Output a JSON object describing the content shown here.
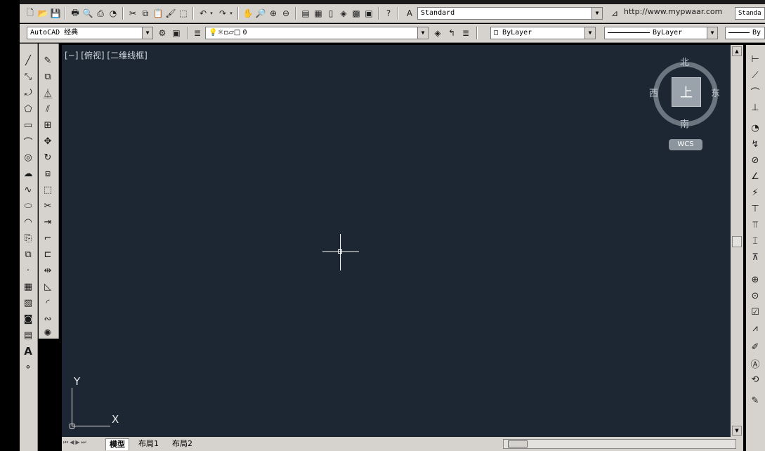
{
  "toolbar": {
    "text_style": "Standard",
    "watermark_url": "http://www.mypwaar.com",
    "table_style_fragment": "Standa",
    "workspace": "AutoCAD 经典",
    "layer": "0",
    "color": "ByLayer",
    "linetype": "ByLayer",
    "lineweight_fragment": "By"
  },
  "viewport": {
    "label": "[−] [俯视] [二维线框]"
  },
  "viewcube": {
    "north": "北",
    "south": "南",
    "east": "东",
    "west": "西",
    "top": "上",
    "wcs": "WCS"
  },
  "ucs": {
    "x_label": "X",
    "y_label": "Y"
  },
  "tabs": [
    {
      "label": "模型"
    },
    {
      "label": "布局1"
    },
    {
      "label": "布局2"
    }
  ]
}
